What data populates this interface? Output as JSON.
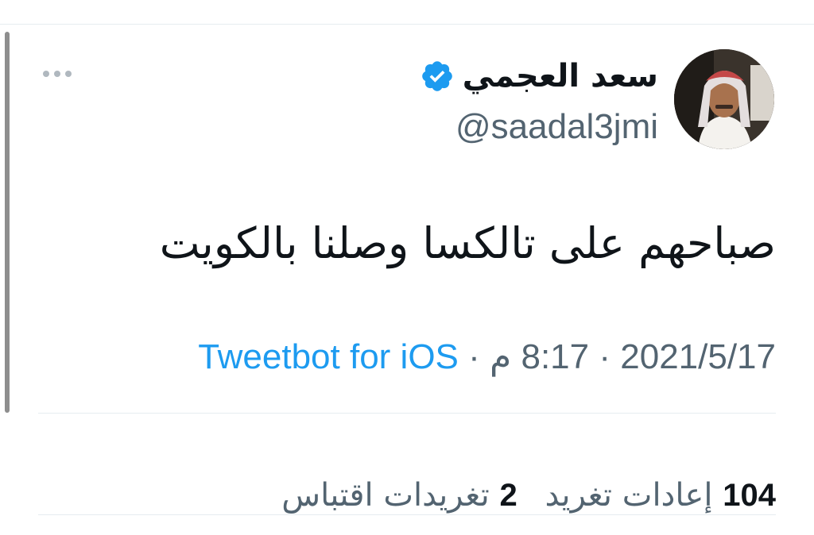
{
  "tweet": {
    "author": {
      "display_name": "سعد العجمي",
      "handle": "@saadal3jmi",
      "verified": true,
      "verified_icon": "verified-badge-icon",
      "avatar_icon": "profile-photo"
    },
    "more_icon": "more-options-icon",
    "text": "صباحهم على تالكسا وصلنا بالكويت",
    "meta": {
      "time": "8:17 م",
      "separator": "·",
      "date": "2021/5/17",
      "source": "Tweetbot for iOS"
    },
    "stats": [
      {
        "count": "104",
        "label": "إعادات تغريد"
      },
      {
        "count": "2",
        "label": "تغريدات اقتباس"
      }
    ]
  },
  "colors": {
    "text_primary": "#0f1419",
    "text_secondary": "#536471",
    "link": "#1d9bf0",
    "verified": "#1d9bf0",
    "divider": "#e6ecf0"
  }
}
